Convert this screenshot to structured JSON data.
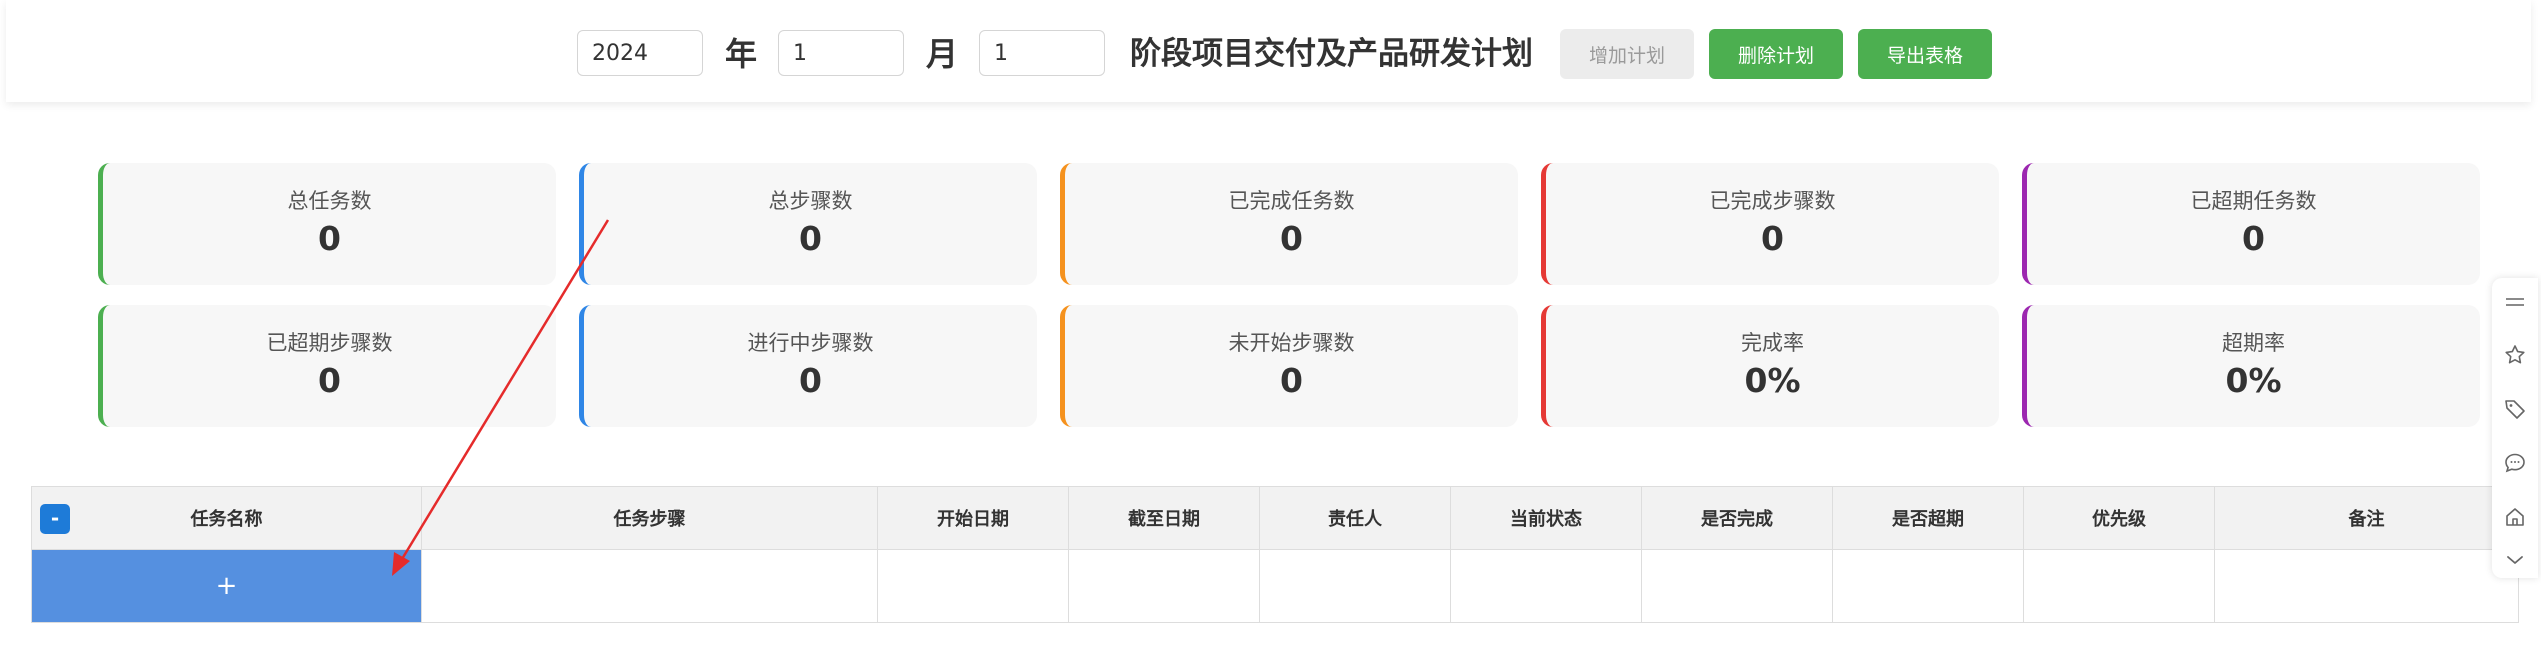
{
  "header": {
    "year_value": "2024",
    "year_unit": "年",
    "month_value": "1",
    "month_unit": "月",
    "stage_value": "1",
    "title": "阶段项目交付及产品研发计划",
    "add_plan_label": "增加计划",
    "delete_plan_label": "删除计划",
    "export_label": "导出表格"
  },
  "stats": [
    {
      "label": "总任务数",
      "value": "0",
      "color": "#4caf50"
    },
    {
      "label": "总步骤数",
      "value": "0",
      "color": "#2f86e6"
    },
    {
      "label": "已完成任务数",
      "value": "0",
      "color": "#f5921e"
    },
    {
      "label": "已完成步骤数",
      "value": "0",
      "color": "#e53935"
    },
    {
      "label": "已超期任务数",
      "value": "0",
      "color": "#9c27b0"
    },
    {
      "label": "已超期步骤数",
      "value": "0",
      "color": "#4caf50"
    },
    {
      "label": "进行中步骤数",
      "value": "0",
      "color": "#2f86e6"
    },
    {
      "label": "未开始步骤数",
      "value": "0",
      "color": "#f5921e"
    },
    {
      "label": "完成率",
      "value": "0%",
      "color": "#e53935"
    },
    {
      "label": "超期率",
      "value": "0%",
      "color": "#9c27b0"
    }
  ],
  "table": {
    "collapse_label": "-",
    "columns": [
      "任务名称",
      "任务步骤",
      "开始日期",
      "截至日期",
      "责任人",
      "当前状态",
      "是否完成",
      "是否超期",
      "优先级",
      "备注"
    ],
    "add_row_label": "+"
  },
  "side_toolbar": {
    "icons": [
      "menu-lines-icon",
      "star-icon",
      "tag-icon",
      "comment-icon",
      "home-icon",
      "chevron-down-icon"
    ]
  },
  "colors": {
    "primary_green": "#4caf50",
    "add_row_blue": "#5590e0",
    "annotation_red": "#e52b2b"
  }
}
